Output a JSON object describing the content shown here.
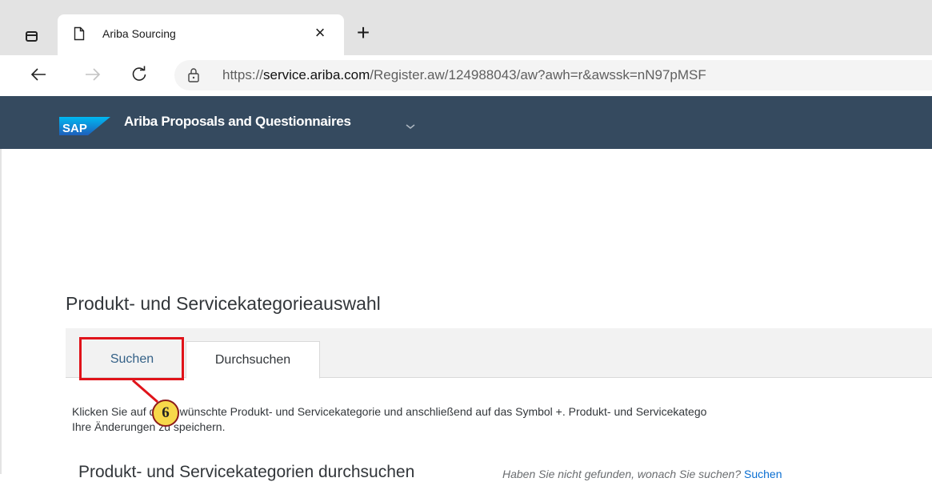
{
  "browser": {
    "tab_title": "Ariba Sourcing",
    "new_tab_label": "+",
    "close_label": "×",
    "url_prefix": "https://",
    "url_host": "service.ariba.com",
    "url_path": "/Register.aw/124988043/aw?awh=r&awssk=nN97pMSF",
    "icons": {
      "tab_actions": "tab-actions-icon",
      "page": "page-icon",
      "back": "back-arrow-icon",
      "forward": "forward-arrow-icon",
      "reload": "reload-icon",
      "lock": "lock-icon"
    }
  },
  "header": {
    "logo_text": "SAP",
    "app_title": "Ariba Proposals and Questionnaires",
    "bg_color": "#354a5f"
  },
  "page": {
    "title": "Produkt- und Servicekategorieauswahl",
    "tabs": [
      {
        "label": "Suchen",
        "selected": false
      },
      {
        "label": "Durchsuchen",
        "selected": true
      }
    ],
    "instructions_line1": "Klicken Sie auf die gewünschte Produkt- und Servicekategorie und anschließend auf das Symbol +. Produkt- und Servicekatego",
    "instructions_line2": "Ihre Änderungen zu speichern.",
    "section_heading": "Produkt- und Servicekategorien durchsuchen",
    "section_hint": "Haben Sie nicht gefunden, wonach Sie suchen?",
    "section_hint_link": "Suchen"
  },
  "annotation": {
    "step_number": "6",
    "highlight_color": "#e0131a"
  }
}
